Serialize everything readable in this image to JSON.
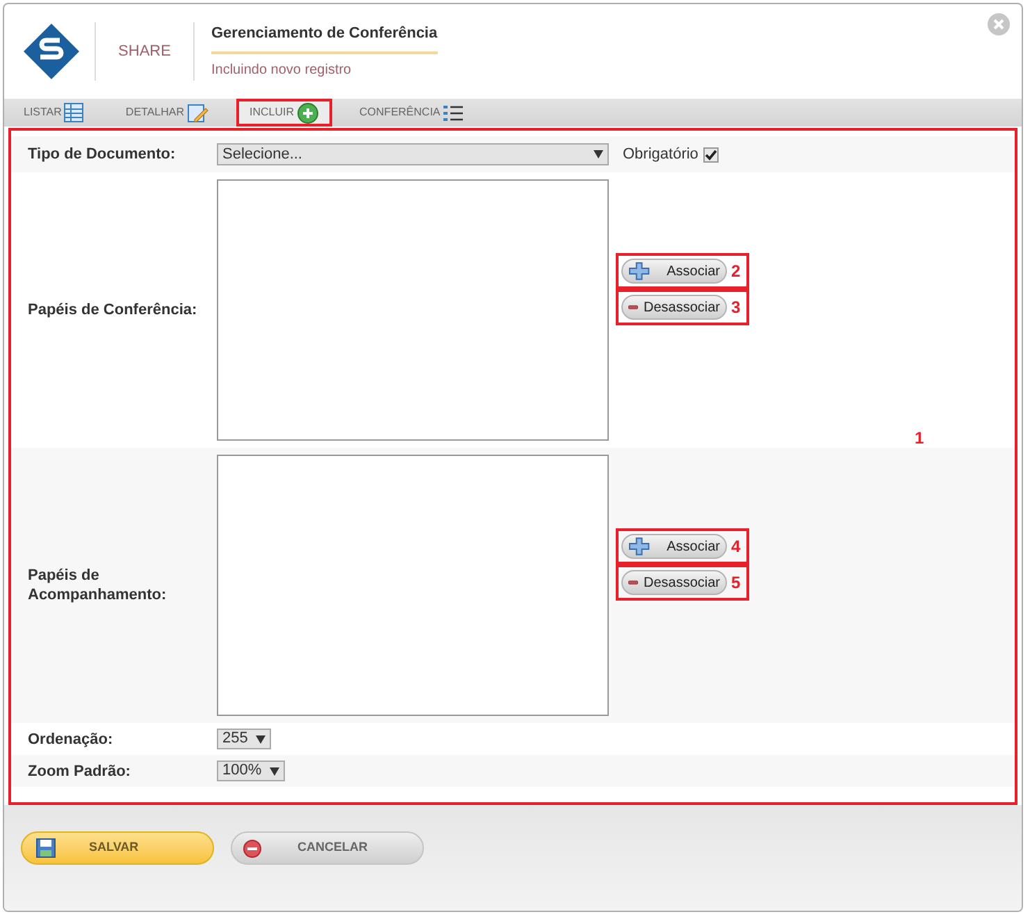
{
  "header": {
    "brand": "SHARE",
    "title": "Gerenciamento de Conferência",
    "subtitle": "Incluindo novo registro"
  },
  "tabs": [
    {
      "label": "LISTAR",
      "kind": "table",
      "selected": false,
      "highlighted": false
    },
    {
      "label": "DETALHAR",
      "kind": "edit",
      "selected": false,
      "highlighted": false
    },
    {
      "label": "INCLUIR",
      "kind": "add",
      "selected": true,
      "highlighted": true
    },
    {
      "label": "CONFERÊNCIA",
      "kind": "list",
      "selected": false,
      "highlighted": false
    }
  ],
  "form": {
    "marker": "1",
    "fields": [
      {
        "kind": "select",
        "label": "Tipo de Documento:",
        "value": "Selecione...",
        "checkbox": {
          "label": "Obrigatório",
          "checked": true
        }
      },
      {
        "kind": "listbox",
        "label": "Papéis de Conferência:",
        "buttons": [
          {
            "kind": "add",
            "label": "Associar",
            "marker": "2"
          },
          {
            "kind": "remove",
            "label": "Desassociar",
            "marker": "3"
          }
        ]
      },
      {
        "kind": "listbox",
        "label": "Papéis de Acompanhamento:",
        "buttons": [
          {
            "kind": "add",
            "label": "Associar",
            "marker": "4"
          },
          {
            "kind": "remove",
            "label": "Desassociar",
            "marker": "5"
          }
        ]
      },
      {
        "kind": "small-select",
        "label": "Ordenação:",
        "value": "255"
      },
      {
        "kind": "small-select",
        "label": "Zoom Padrão:",
        "value": "100%"
      }
    ]
  },
  "footer": [
    {
      "kind": "save",
      "label": "SALVAR"
    },
    {
      "kind": "cancel",
      "label": "CANCELAR"
    }
  ]
}
